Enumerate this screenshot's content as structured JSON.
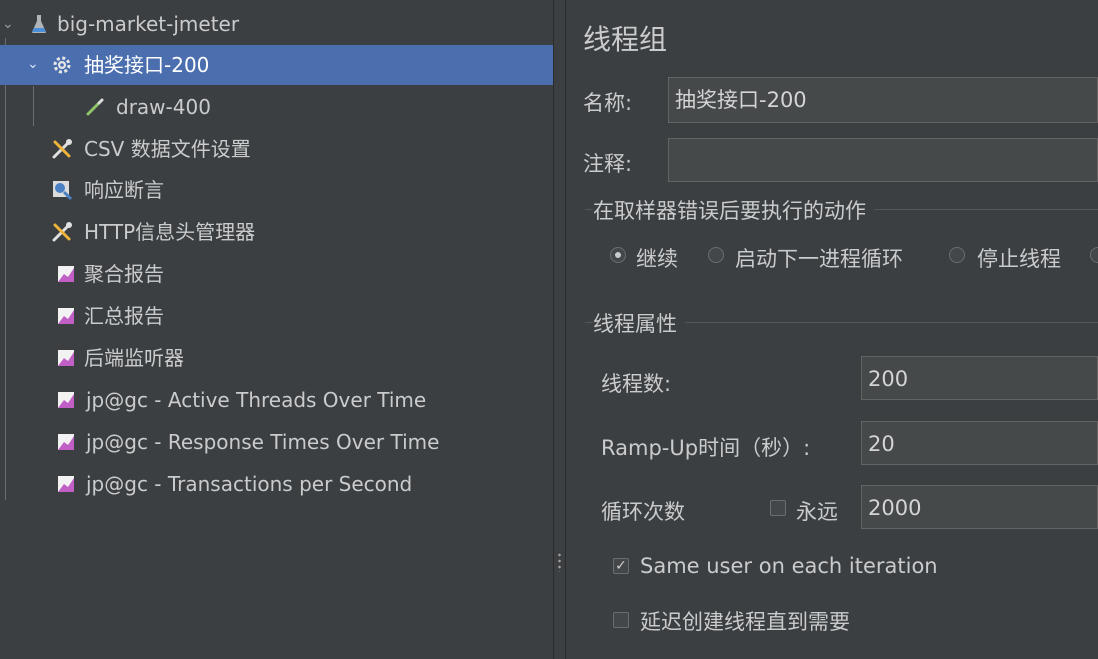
{
  "tree": {
    "root": {
      "label": "big-market-jmeter",
      "icon": "flask-icon"
    },
    "items": [
      {
        "label": "抽奖接口-200",
        "icon": "gear-icon",
        "selected": true
      },
      {
        "label": "draw-400",
        "icon": "pipette-icon"
      },
      {
        "label": "CSV 数据文件设置",
        "icon": "wrench-screwdriver-icon"
      },
      {
        "label": "响应断言",
        "icon": "magnifier-icon"
      },
      {
        "label": "HTTP信息头管理器",
        "icon": "wrench-screwdriver-icon"
      },
      {
        "label": "聚合报告",
        "icon": "chart-icon"
      },
      {
        "label": "汇总报告",
        "icon": "chart-icon"
      },
      {
        "label": "后端监听器",
        "icon": "chart-icon"
      },
      {
        "label": "jp@gc - Active Threads Over Time",
        "icon": "chart-icon"
      },
      {
        "label": "jp@gc - Response Times Over Time",
        "icon": "chart-icon"
      },
      {
        "label": "jp@gc - Transactions per Second",
        "icon": "chart-icon"
      }
    ]
  },
  "panel": {
    "title": "线程组",
    "name_label": "名称:",
    "name_value": "抽奖接口-200",
    "comment_label": "注释:",
    "comment_value": "",
    "error_section": "在取样器错误后要执行的动作",
    "error_options": [
      "继续",
      "启动下一进程循环",
      "停止线程"
    ],
    "error_selected": "继续",
    "props_section": "线程属性",
    "threads_label": "线程数:",
    "threads_value": "200",
    "rampup_label": "Ramp-Up时间（秒）:",
    "rampup_value": "20",
    "loop_label": "循环次数",
    "forever_label": "永远",
    "forever_checked": false,
    "loop_value": "2000",
    "same_user_label": "Same user on each iteration",
    "same_user_checked": true,
    "delay_label": "延迟创建线程直到需要",
    "delay_checked": false
  },
  "colors": {
    "background": "#3c3f41",
    "selection": "#4b6eaf",
    "field_bg": "#45494a",
    "text": "#c9cbcd"
  }
}
